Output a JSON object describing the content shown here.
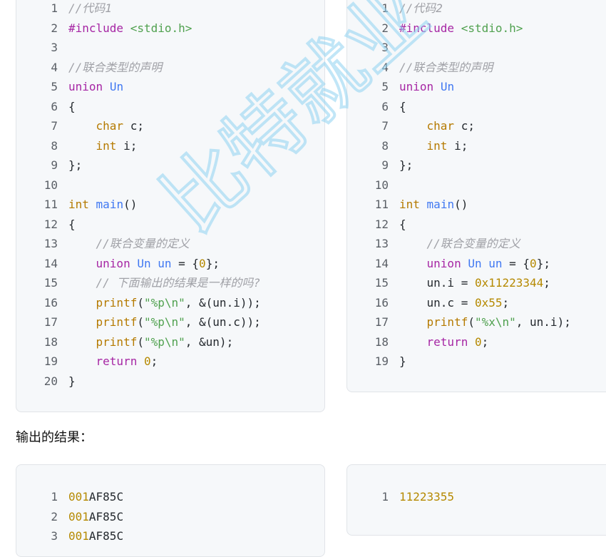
{
  "code_blocks": [
    {
      "lines": [
        [
          [
            "comment",
            "//代码1"
          ]
        ],
        [
          [
            "keyword",
            "#include"
          ],
          [
            "plain",
            " "
          ],
          [
            "string",
            "<stdio.h>"
          ]
        ],
        [],
        [
          [
            "comment",
            "//联合类型的声明"
          ]
        ],
        [
          [
            "keyword",
            "union"
          ],
          [
            "plain",
            " "
          ],
          [
            "name",
            "Un"
          ]
        ],
        [
          [
            "plain",
            "{"
          ]
        ],
        [
          [
            "plain",
            "    "
          ],
          [
            "type",
            "char"
          ],
          [
            "plain",
            " c;"
          ]
        ],
        [
          [
            "plain",
            "    "
          ],
          [
            "type",
            "int"
          ],
          [
            "plain",
            " i;"
          ]
        ],
        [
          [
            "plain",
            "};"
          ]
        ],
        [],
        [
          [
            "type",
            "int"
          ],
          [
            "plain",
            " "
          ],
          [
            "name",
            "main"
          ],
          [
            "plain",
            "()"
          ]
        ],
        [
          [
            "plain",
            "{"
          ]
        ],
        [
          [
            "plain",
            "    "
          ],
          [
            "comment",
            "//联合变量的定义"
          ]
        ],
        [
          [
            "plain",
            "    "
          ],
          [
            "keyword",
            "union"
          ],
          [
            "plain",
            " "
          ],
          [
            "name",
            "Un"
          ],
          [
            "plain",
            " "
          ],
          [
            "name",
            "un"
          ],
          [
            "plain",
            " = {"
          ],
          [
            "number",
            "0"
          ],
          [
            "plain",
            "};"
          ]
        ],
        [
          [
            "plain",
            "    "
          ],
          [
            "comment",
            "// 下面输出的结果是一样的吗?"
          ]
        ],
        [
          [
            "plain",
            "    "
          ],
          [
            "type",
            "printf"
          ],
          [
            "plain",
            "("
          ],
          [
            "string",
            "\"%p\\n\""
          ],
          [
            "plain",
            ", &(un.i));"
          ]
        ],
        [
          [
            "plain",
            "    "
          ],
          [
            "type",
            "printf"
          ],
          [
            "plain",
            "("
          ],
          [
            "string",
            "\"%p\\n\""
          ],
          [
            "plain",
            ", &(un.c));"
          ]
        ],
        [
          [
            "plain",
            "    "
          ],
          [
            "type",
            "printf"
          ],
          [
            "plain",
            "("
          ],
          [
            "string",
            "\"%p\\n\""
          ],
          [
            "plain",
            ", &un);"
          ]
        ],
        [
          [
            "plain",
            "    "
          ],
          [
            "keyword",
            "return"
          ],
          [
            "plain",
            " "
          ],
          [
            "number",
            "0"
          ],
          [
            "plain",
            ";"
          ]
        ],
        [
          [
            "plain",
            "}"
          ]
        ]
      ]
    },
    {
      "lines": [
        [
          [
            "comment",
            "//代码2"
          ]
        ],
        [
          [
            "keyword",
            "#include"
          ],
          [
            "plain",
            " "
          ],
          [
            "string",
            "<stdio.h>"
          ]
        ],
        [],
        [
          [
            "comment",
            "//联合类型的声明"
          ]
        ],
        [
          [
            "keyword",
            "union"
          ],
          [
            "plain",
            " "
          ],
          [
            "name",
            "Un"
          ]
        ],
        [
          [
            "plain",
            "{"
          ]
        ],
        [
          [
            "plain",
            "    "
          ],
          [
            "type",
            "char"
          ],
          [
            "plain",
            " c;"
          ]
        ],
        [
          [
            "plain",
            "    "
          ],
          [
            "type",
            "int"
          ],
          [
            "plain",
            " i;"
          ]
        ],
        [
          [
            "plain",
            "};"
          ]
        ],
        [],
        [
          [
            "type",
            "int"
          ],
          [
            "plain",
            " "
          ],
          [
            "name",
            "main"
          ],
          [
            "plain",
            "()"
          ]
        ],
        [
          [
            "plain",
            "{"
          ]
        ],
        [
          [
            "plain",
            "    "
          ],
          [
            "comment",
            "//联合变量的定义"
          ]
        ],
        [
          [
            "plain",
            "    "
          ],
          [
            "keyword",
            "union"
          ],
          [
            "plain",
            " "
          ],
          [
            "name",
            "Un"
          ],
          [
            "plain",
            " "
          ],
          [
            "name",
            "un"
          ],
          [
            "plain",
            " = {"
          ],
          [
            "number",
            "0"
          ],
          [
            "plain",
            "};"
          ]
        ],
        [
          [
            "plain",
            "    un.i = "
          ],
          [
            "number",
            "0x11223344"
          ],
          [
            "plain",
            ";"
          ]
        ],
        [
          [
            "plain",
            "    un.c = "
          ],
          [
            "number",
            "0x55"
          ],
          [
            "plain",
            ";"
          ]
        ],
        [
          [
            "plain",
            "    "
          ],
          [
            "type",
            "printf"
          ],
          [
            "plain",
            "("
          ],
          [
            "string",
            "\"%x\\n\""
          ],
          [
            "plain",
            ", un.i);"
          ]
        ],
        [
          [
            "plain",
            "    "
          ],
          [
            "keyword",
            "return"
          ],
          [
            "plain",
            " "
          ],
          [
            "number",
            "0"
          ],
          [
            "plain",
            ";"
          ]
        ],
        [
          [
            "plain",
            "}"
          ]
        ]
      ]
    },
    {
      "lines": [
        [
          [
            "number",
            "001"
          ],
          [
            "plain",
            "AF85C"
          ]
        ],
        [
          [
            "number",
            "001"
          ],
          [
            "plain",
            "AF85C"
          ]
        ],
        [
          [
            "number",
            "001"
          ],
          [
            "plain",
            "AF85C"
          ]
        ]
      ]
    },
    {
      "lines": [
        [
          [
            "number",
            "11223355"
          ]
        ]
      ]
    }
  ],
  "output_heading": "输出的结果：",
  "watermark": {
    "text": "比特就业"
  },
  "colors": {
    "comment": "#a0a1a7",
    "keyword": "#a626a4",
    "type": "#b57a00",
    "name": "#4078f2",
    "string": "#50a14f",
    "number": "#b58900",
    "panel_background": "#f6f8fa",
    "watermark": "#8fd2f2"
  }
}
